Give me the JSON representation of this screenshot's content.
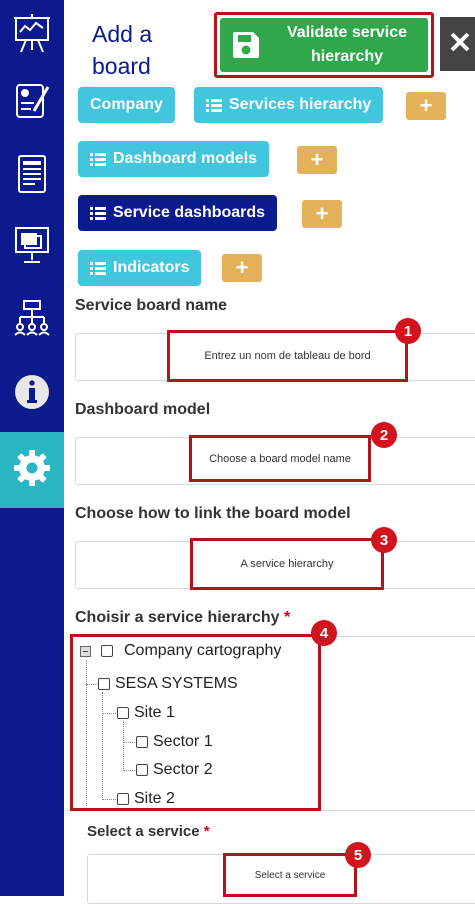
{
  "header": {
    "title": "Add a board",
    "validate_label": "Validate service hierarchy",
    "close_label": "✕"
  },
  "tags": {
    "company": "Company",
    "services_hierarchy": "Services hierarchy",
    "dashboard_models": "Dashboard models",
    "service_dashboards": "Service dashboards",
    "indicators": "Indicators",
    "plus": "+"
  },
  "form": {
    "board_name_label": "Service board name",
    "board_name_placeholder": "Entrez un nom de tableau de bord",
    "model_label": "Dashboard model",
    "model_value": "Choose a board model name",
    "link_label": "Choose how to link the board model",
    "link_value": "A service hierarchy",
    "hierarchy_label": "Choisir a service hierarchy",
    "service_label": "Select a service",
    "service_value": "Select a service",
    "required_mark": "*"
  },
  "tree": {
    "root": "Company cartography",
    "n1": "SESA SYSTEMS",
    "n2": "Site 1",
    "n3": "Sector 1",
    "n4": "Sector 2",
    "n5": "Site 2"
  },
  "badges": [
    "1",
    "2",
    "3",
    "4",
    "5"
  ],
  "colors": {
    "sidebar": "#0b1a8c",
    "sidebar_active": "#2ab6c2",
    "accent_green": "#2ea84a",
    "tag_light": "#41c6de",
    "tag_dark": "#0b1a8c",
    "plus": "#e3b15a",
    "highlight": "#b5121b"
  },
  "sidebar_icons": [
    "presentation-board-icon",
    "document-edit-icon",
    "report-icon",
    "projector-screen-icon",
    "hierarchy-icon",
    "info-icon",
    "settings-icon"
  ]
}
